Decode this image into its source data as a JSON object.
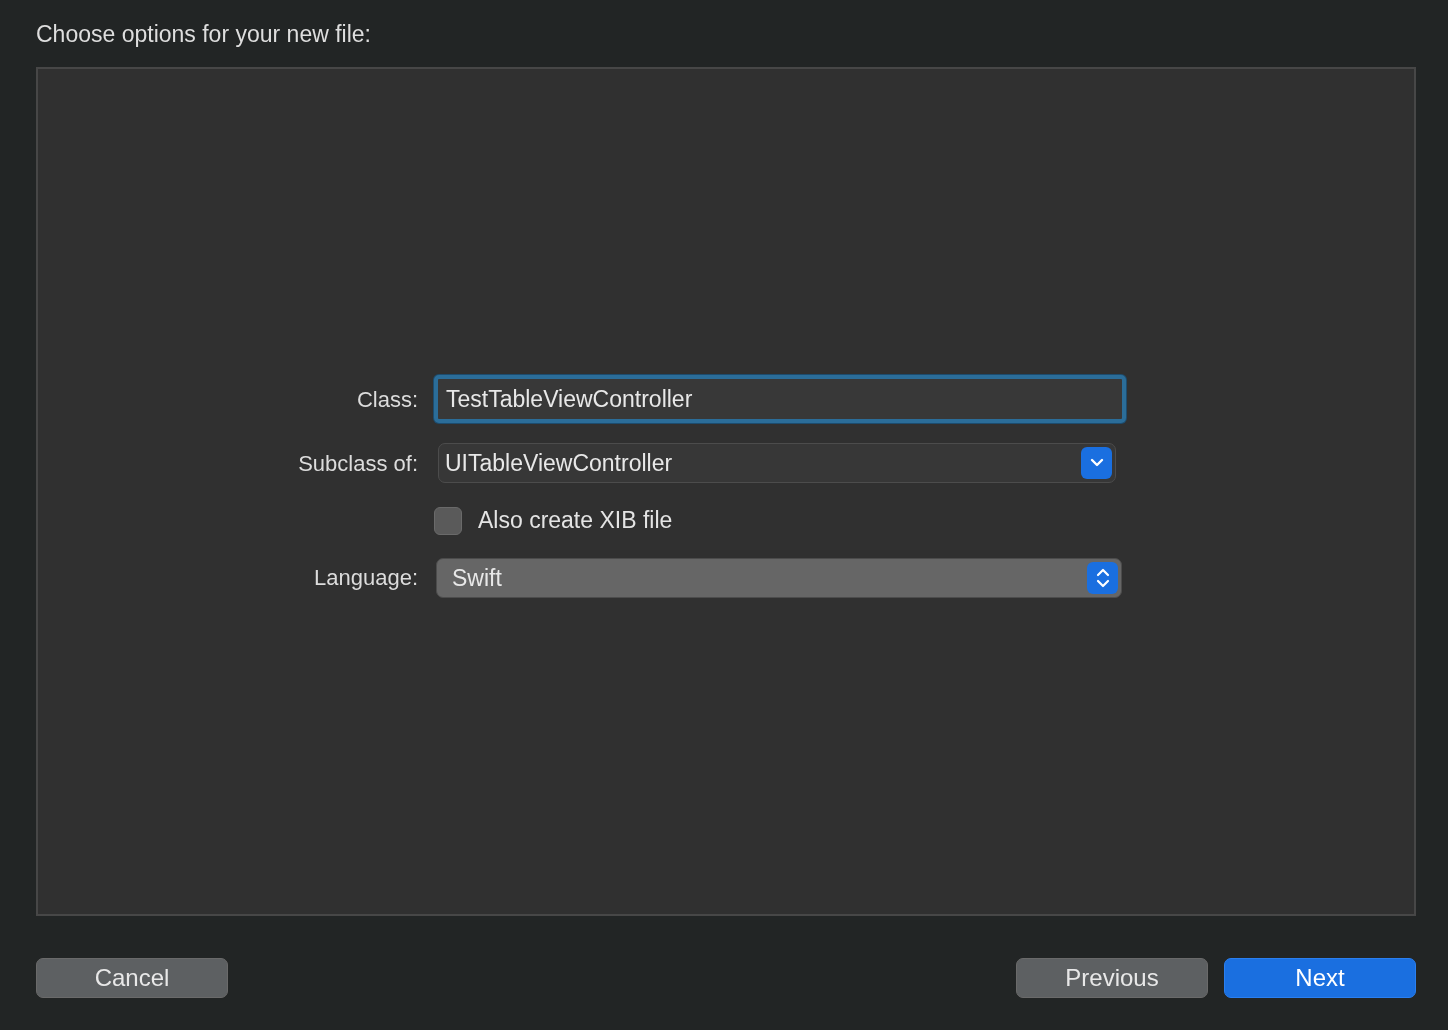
{
  "title": "Choose options for your new file:",
  "form": [
    {
      "kind": "text",
      "label": "Class:",
      "value": "TestTableViewController",
      "focused": true
    },
    {
      "kind": "pulldown",
      "label": "Subclass of:",
      "value": "UITableViewController"
    },
    {
      "kind": "checkbox",
      "text": "Also create XIB file",
      "checked": false
    },
    {
      "kind": "popup",
      "label": "Language:",
      "value": "Swift"
    }
  ],
  "left_buttons": [
    {
      "label": "Cancel",
      "default": false
    }
  ],
  "right_buttons": [
    {
      "label": "Previous",
      "default": false
    },
    {
      "label": "Next",
      "default": true
    }
  ]
}
